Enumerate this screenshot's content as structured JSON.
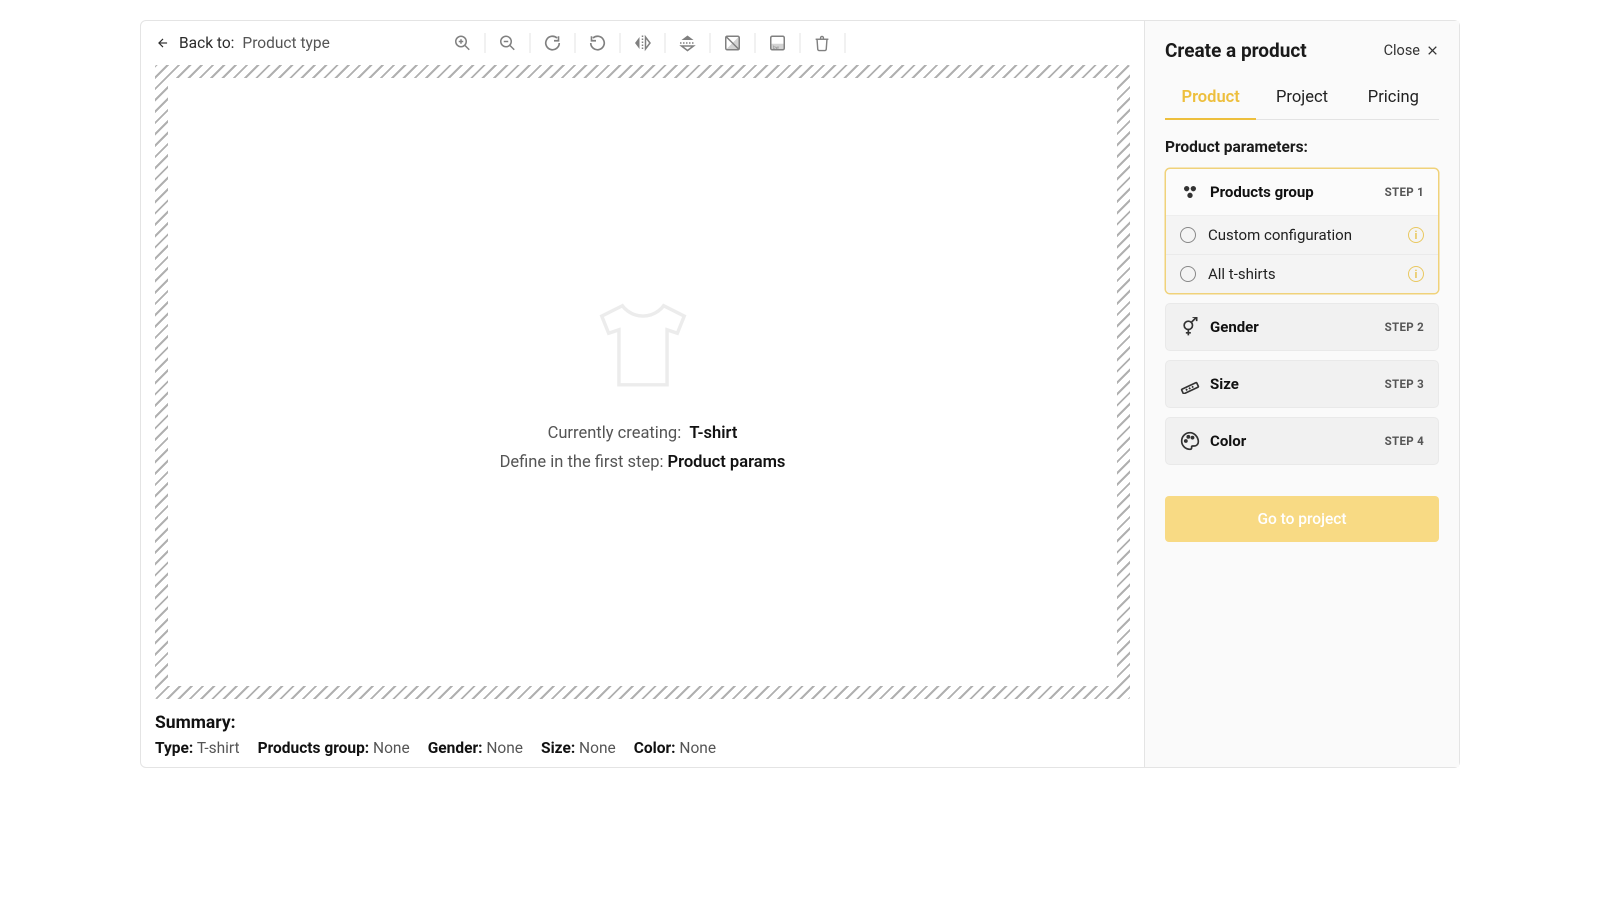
{
  "breadcrumb": {
    "back_label": "Back to:",
    "target": "Product type"
  },
  "canvas": {
    "line1_prefix": "Currently creating:",
    "line1_value": "T-shirt",
    "line2_prefix": "Define in the first step:",
    "line2_value": "Product params"
  },
  "summary": {
    "heading": "Summary:",
    "items": {
      "type": {
        "label": "Type:",
        "value": "T-shirt"
      },
      "group": {
        "label": "Products group:",
        "value": "None"
      },
      "gender": {
        "label": "Gender:",
        "value": "None"
      },
      "size": {
        "label": "Size:",
        "value": "None"
      },
      "color": {
        "label": "Color:",
        "value": "None"
      }
    }
  },
  "sidebar": {
    "title": "Create a product",
    "close": "Close",
    "tabs": {
      "product": "Product",
      "project": "Project",
      "pricing": "Pricing"
    },
    "section_label": "Product parameters:",
    "steps": {
      "group": {
        "title": "Products group",
        "badge": "STEP 1",
        "options": {
          "custom": "Custom configuration",
          "all": "All t-shirts"
        }
      },
      "gender": {
        "title": "Gender",
        "badge": "STEP 2"
      },
      "size": {
        "title": "Size",
        "badge": "STEP 3"
      },
      "color": {
        "title": "Color",
        "badge": "STEP 4"
      }
    },
    "cta": "Go to project"
  }
}
